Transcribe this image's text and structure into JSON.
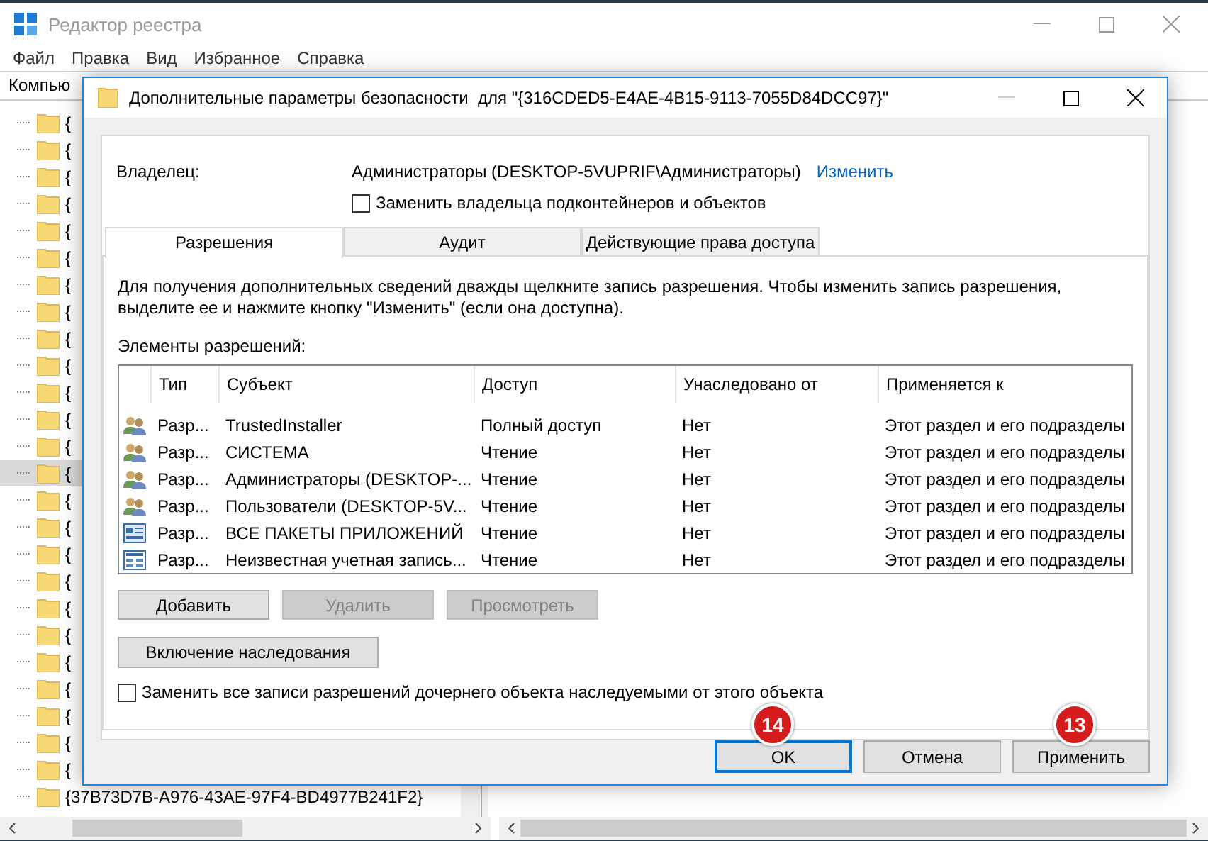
{
  "registry_window": {
    "title": "Редактор реестра",
    "menu": [
      "Файл",
      "Правка",
      "Вид",
      "Избранное",
      "Справка"
    ],
    "address": "Компью",
    "tree_items": [
      {
        "label": "{",
        "selected": false
      },
      {
        "label": "{",
        "selected": false
      },
      {
        "label": "{",
        "selected": false
      },
      {
        "label": "{",
        "selected": false
      },
      {
        "label": "{",
        "selected": false
      },
      {
        "label": "{",
        "selected": false
      },
      {
        "label": "{",
        "selected": false
      },
      {
        "label": "{",
        "selected": false
      },
      {
        "label": "{",
        "selected": false
      },
      {
        "label": "{",
        "selected": false
      },
      {
        "label": "{",
        "selected": false
      },
      {
        "label": "{",
        "selected": false
      },
      {
        "label": "{",
        "selected": false
      },
      {
        "label": "{",
        "selected": true
      },
      {
        "label": "{",
        "selected": false
      },
      {
        "label": "{",
        "selected": false
      },
      {
        "label": "{",
        "selected": false
      },
      {
        "label": "{",
        "selected": false
      },
      {
        "label": "{",
        "selected": false
      },
      {
        "label": "{",
        "selected": false
      },
      {
        "label": "{",
        "selected": false
      },
      {
        "label": "{",
        "selected": false
      },
      {
        "label": "{",
        "selected": false
      },
      {
        "label": "{",
        "selected": false
      },
      {
        "label": "{",
        "selected": false
      },
      {
        "label": "{37B73D7B-A976-43AE-97F4-BD4977B241F2}",
        "selected": false
      }
    ]
  },
  "dialog": {
    "title": "Дополнительные параметры безопасности  для \"{316CDED5-E4AE-4B15-9113-7055D84DCC97}\"",
    "owner_label": "Владелец:",
    "owner_value": "Администраторы (DESKTOP-5VUPRIF\\Администраторы)",
    "owner_change_link": "Изменить",
    "replace_owner": {
      "label": "Заменить владельца подконтейнеров и объектов",
      "checked": false
    },
    "tabs": [
      {
        "label": "Разрешения",
        "selected": true
      },
      {
        "label": "Аудит",
        "selected": false
      },
      {
        "label": "Действующие права доступа",
        "selected": false
      }
    ],
    "description": "Для получения дополнительных сведений дважды щелкните запись разрешения. Чтобы изменить запись разрешения, выделите ее и нажмите кнопку \"Изменить\" (если она доступна).",
    "entries_label": "Элементы разрешений:",
    "table": {
      "columns": [
        "Тип",
        "Субъект",
        "Доступ",
        "Унаследовано от",
        "Применяется к"
      ],
      "rows": [
        {
          "kind": "users",
          "type": "Разр...",
          "subject": "TrustedInstaller",
          "access": "Полный доступ",
          "inherited_from": "Нет",
          "applies_to": "Этот раздел и его подразделы"
        },
        {
          "kind": "users",
          "type": "Разр...",
          "subject": "СИСТЕМА",
          "access": "Чтение",
          "inherited_from": "Нет",
          "applies_to": "Этот раздел и его подразделы"
        },
        {
          "kind": "users",
          "type": "Разр...",
          "subject": "Администраторы (DESKTOP-...",
          "access": "Чтение",
          "inherited_from": "Нет",
          "applies_to": "Этот раздел и его подразделы"
        },
        {
          "kind": "users",
          "type": "Разр...",
          "subject": "Пользователи (DESKTOP-5V...",
          "access": "Чтение",
          "inherited_from": "Нет",
          "applies_to": "Этот раздел и его подразделы"
        },
        {
          "kind": "package",
          "type": "Разр...",
          "subject": "ВСЕ ПАКЕТЫ ПРИЛОЖЕНИЙ",
          "access": "Чтение",
          "inherited_from": "Нет",
          "applies_to": "Этот раздел и его подразделы"
        },
        {
          "kind": "account",
          "type": "Разр...",
          "subject": "Неизвестная учетная запись...",
          "access": "Чтение",
          "inherited_from": "Нет",
          "applies_to": "Этот раздел и его подразделы"
        }
      ]
    },
    "buttons": [
      {
        "label": "Добавить",
        "disabled": false
      },
      {
        "label": "Удалить",
        "disabled": true
      },
      {
        "label": "Просмотреть",
        "disabled": true
      }
    ],
    "inheritance_button": "Включение наследования",
    "replace_child": {
      "label": "Заменить все записи разрешений дочернего объекта наследуемыми от этого объекта",
      "checked": false
    },
    "footer_buttons": [
      {
        "label": "OK",
        "default": true
      },
      {
        "label": "Отмена",
        "default": false
      },
      {
        "label": "Применить",
        "default": false
      }
    ]
  },
  "annotations": [
    {
      "label": "14"
    },
    {
      "label": "13"
    }
  ]
}
